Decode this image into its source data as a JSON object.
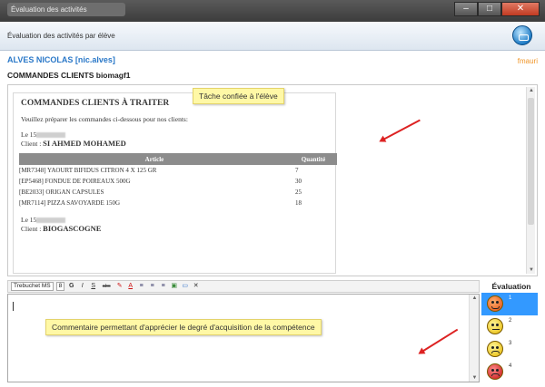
{
  "window": {
    "title": "Évaluation des activités"
  },
  "header": {
    "title": "Évaluation des activités par élève"
  },
  "student": {
    "name": "ALVES NICOLAS [nic.alves]",
    "user": "fmauri"
  },
  "context": {
    "title": "COMMANDES CLIENTS biomagf1"
  },
  "document": {
    "heading": "COMMANDES CLIENTS À TRAITER",
    "intro": "Veuillez préparer les commandes ci-dessous pour nos clients:",
    "order1": {
      "date_prefix": "Le 15",
      "client_label": "Client :",
      "client_name": "SI AHMED MOHAMED"
    },
    "table": {
      "headers": [
        "Article",
        "Quantité"
      ],
      "rows": [
        [
          "[MR7348] YAOURT BIFIDUS CITRON 4 X 125 GR",
          "7"
        ],
        [
          "[EP5468] FONDUE DE POIREAUX 500G",
          "30"
        ],
        [
          "[BE2033] ORIGAN CAPSULES",
          "25"
        ],
        [
          "[MR7114] PIZZA SAVOYARDE 150G",
          "18"
        ]
      ]
    },
    "order2": {
      "date_prefix": "Le 15",
      "client_label": "Client :",
      "client_name": "BIOGASCOGNE"
    }
  },
  "callouts": {
    "task": "Tâche confiée à l'élève",
    "comment": "Commentaire permettant d'apprécier le degré d'acquisition de la compétence"
  },
  "toolbar": {
    "font": "Trebuchet MS",
    "size": "8",
    "buttons": [
      "G",
      "I",
      "S",
      "abc",
      "A"
    ]
  },
  "evaluation": {
    "title": "Évaluation",
    "levels": [
      {
        "number": "1",
        "selected": true,
        "icon": "angry-smiley-icon"
      },
      {
        "number": "2",
        "selected": false,
        "icon": "neutral-smiley-icon"
      },
      {
        "number": "3",
        "selected": false,
        "icon": "happy-smiley-icon"
      },
      {
        "number": "4",
        "selected": false,
        "icon": "very-happy-smiley-icon"
      }
    ]
  },
  "colors": {
    "accent": "#2a78c8",
    "selection": "#3399ff",
    "user": "#f0962a",
    "callout": "#fff8a6",
    "arrow": "#dd2222"
  }
}
